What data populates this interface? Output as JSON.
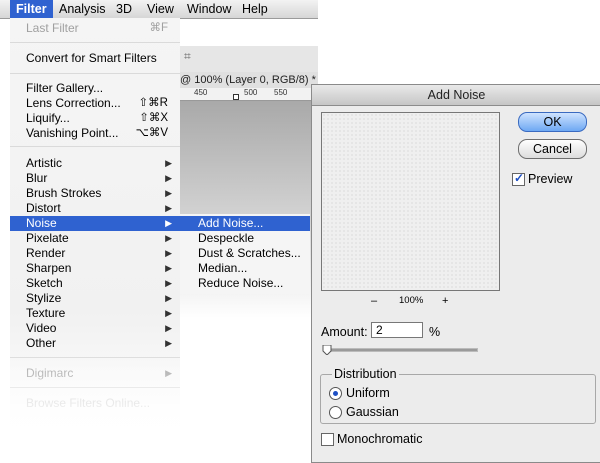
{
  "menubar": {
    "items": [
      {
        "label": "Filter",
        "active": true
      },
      {
        "label": "Analysis",
        "active": false
      },
      {
        "label": "3D",
        "active": false
      },
      {
        "label": "View",
        "active": false
      },
      {
        "label": "Window",
        "active": false
      },
      {
        "label": "Help",
        "active": false
      }
    ]
  },
  "background_window": {
    "options_glyph": "⌗",
    "doc_tab": "@ 100% (Layer 0, RGB/8) *",
    "ruler_marks": [
      "450",
      "500",
      "550"
    ]
  },
  "filter_menu": {
    "last_filter": {
      "label": "Last Filter",
      "shortcut": "⌘F"
    },
    "convert": "Convert for Smart Filters",
    "filter_gallery": "Filter Gallery...",
    "lens_correction": {
      "label": "Lens Correction...",
      "shortcut": "⇧⌘R"
    },
    "liquify": {
      "label": "Liquify...",
      "shortcut": "⇧⌘X"
    },
    "vanishing_point": {
      "label": "Vanishing Point...",
      "shortcut": "⌥⌘V"
    },
    "categories": [
      "Artistic",
      "Blur",
      "Brush Strokes",
      "Distort",
      "Noise",
      "Pixelate",
      "Render",
      "Sharpen",
      "Sketch",
      "Stylize",
      "Texture",
      "Video",
      "Other"
    ],
    "highlighted": "Noise",
    "digimarc": "Digimarc",
    "browse_online": "Browse Filters Online...",
    "arrow": "▶"
  },
  "noise_submenu": {
    "items": [
      "Add Noise...",
      "Despeckle",
      "Dust & Scratches...",
      "Median...",
      "Reduce Noise..."
    ],
    "highlighted": "Add Noise..."
  },
  "dialog": {
    "title": "Add Noise",
    "ok_label": "OK",
    "cancel_label": "Cancel",
    "preview_label": "Preview",
    "preview_checked": true,
    "zoom_minus": "–",
    "zoom_level": "100%",
    "zoom_plus": "+",
    "amount_label": "Amount:",
    "amount_value": "2",
    "amount_unit": "%",
    "slider_value_percent": 2,
    "distribution_label": "Distribution",
    "uniform_label": "Uniform",
    "gaussian_label": "Gaussian",
    "distribution_selected": "Uniform",
    "monochromatic_label": "Monochromatic",
    "monochromatic_checked": false
  },
  "colors": {
    "highlight": "#2f62d0",
    "default_button": "#6ea8f3"
  }
}
